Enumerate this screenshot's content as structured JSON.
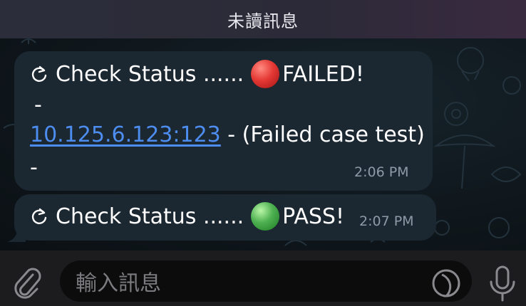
{
  "header": {
    "unread_label": "未讀訊息"
  },
  "messages": [
    {
      "prefix": "Check Status ......",
      "status_icon": "red-circle-icon",
      "status": "FAILED!",
      "dash_1": "-",
      "link": "10.125.6.123:123",
      "detail": " - (Failed case test)",
      "dash_2": "-",
      "time": "2:06 PM"
    },
    {
      "prefix": "Check Status ......",
      "status_icon": "green-circle-icon",
      "status": "PASS!",
      "time": "2:07 PM"
    }
  ],
  "composer": {
    "placeholder": "輸入訊息"
  },
  "colors": {
    "bubble": "#1b2731",
    "link": "#4d8df0",
    "timestamp": "#8e9aa5",
    "banner": "#2c2a38"
  }
}
